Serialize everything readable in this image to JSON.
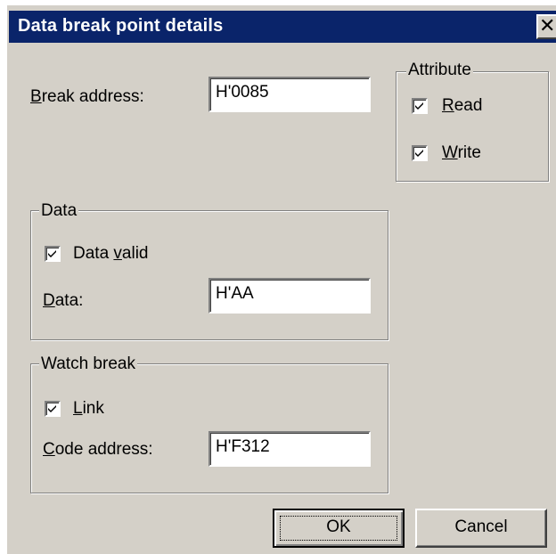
{
  "window": {
    "title": "Data break point details",
    "close_icon": "close-icon"
  },
  "break_address": {
    "label_accel": "B",
    "label_rest": "reak address:",
    "value": "H'0085"
  },
  "attribute": {
    "legend": "Attribute",
    "read": {
      "checked": true,
      "label_accel": "R",
      "label_rest": "ead"
    },
    "write": {
      "checked": true,
      "label_accel": "W",
      "label_rest": "rite"
    }
  },
  "data_group": {
    "legend": "Data",
    "data_valid": {
      "checked": true,
      "label_pre": "Data ",
      "label_accel": "v",
      "label_rest": "alid"
    },
    "data_label_accel": "D",
    "data_label_rest": "ata:",
    "data_value": "H'AA"
  },
  "watch_break": {
    "legend": "Watch break",
    "link": {
      "checked": true,
      "label_accel": "L",
      "label_rest": "ink"
    },
    "code_label_accel": "C",
    "code_label_rest": "ode address:",
    "code_value": "H'F312"
  },
  "buttons": {
    "ok": "OK",
    "cancel": "Cancel"
  },
  "colors": {
    "titlebar": "#0a246a",
    "dialog_face": "#d4d0c8"
  }
}
